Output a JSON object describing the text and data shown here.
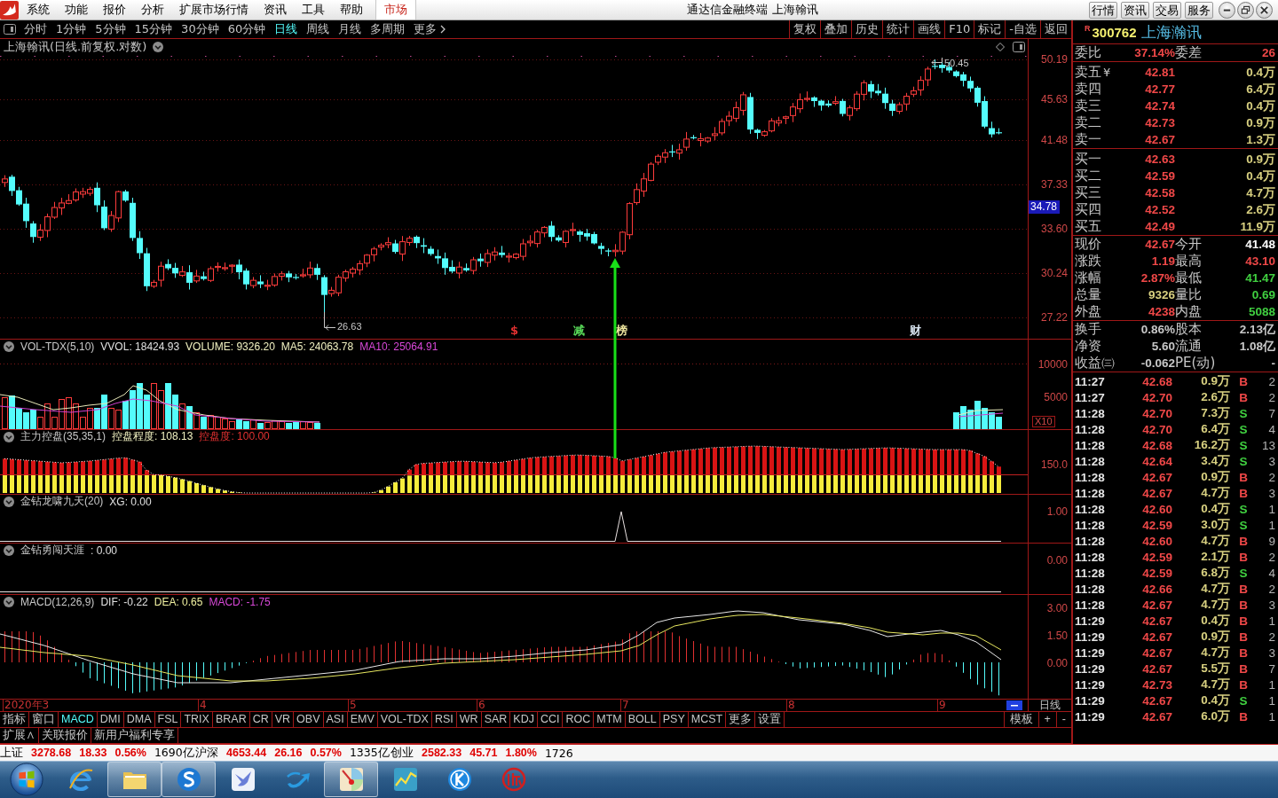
{
  "title_bar": {
    "menus": [
      "系统",
      "功能",
      "报价",
      "分析",
      "扩展市场行情",
      "资讯",
      "工具",
      "帮助"
    ],
    "tabs": [
      {
        "label": "市场",
        "selected": true
      }
    ],
    "title": "通达信金融终端 上海翰讯",
    "buttons": [
      "行情",
      "资讯",
      "交易",
      "服务"
    ]
  },
  "period_bar": {
    "periods": [
      {
        "label": "分时",
        "selected": false
      },
      {
        "label": "1分钟",
        "selected": false
      },
      {
        "label": "5分钟",
        "selected": false
      },
      {
        "label": "15分钟",
        "selected": false
      },
      {
        "label": "30分钟",
        "selected": false
      },
      {
        "label": "60分钟",
        "selected": false
      },
      {
        "label": "日线",
        "selected": true
      },
      {
        "label": "周线",
        "selected": false
      },
      {
        "label": "月线",
        "selected": false
      },
      {
        "label": "多周期",
        "selected": false
      }
    ],
    "more": "更多",
    "tools": [
      "复权",
      "叠加",
      "历史",
      "统计",
      "画线",
      "F10",
      "标记",
      "-自选",
      "返回"
    ]
  },
  "main_chart": {
    "title": "上海翰讯(日线.前复权.对数)",
    "price_ticks": [
      "50.19",
      "45.63",
      "41.48",
      "37.33",
      "33.60",
      "30.24",
      "27.22"
    ],
    "price_tag": "34.78",
    "high_label": "50.45",
    "low_label": "26.63",
    "events": [
      {
        "text": "$",
        "color": "#e03030"
      },
      {
        "text": "减",
        "color": "#58d858"
      },
      {
        "text": "榜",
        "color": "#f0e8a0"
      },
      {
        "text": "财",
        "color": "#d8e4f0"
      }
    ]
  },
  "indicators": [
    {
      "kind": "volume",
      "title": "VOL-TDX(5,10)",
      "readouts": [
        {
          "text": "VVOL: 18424.93",
          "color": "#e0e0e0"
        },
        {
          "text": "VOLUME: 9326.20",
          "color": "#f0f0c0"
        },
        {
          "text": "MA5: 24063.78",
          "color": "#f0f0c0"
        },
        {
          "text": "MA10: 25064.91",
          "color": "#d848d8"
        }
      ],
      "ticks": [
        "10000",
        "5000"
      ],
      "scale": "X10"
    },
    {
      "kind": "control",
      "title": "主力控盘(35,35,1)",
      "readouts": [
        {
          "text": "控盘程度: 108.13",
          "color": "#f0f0c0"
        },
        {
          "text": "控盘度: 100.00",
          "color": "#e03030"
        }
      ],
      "ticks": [
        "150.0"
      ]
    },
    {
      "kind": "signal",
      "title": "金钻龙啸九天(20)",
      "readouts": [
        {
          "text": "XG: 0.00",
          "color": "#e0e0e0"
        }
      ],
      "ticks": [
        "1.00"
      ]
    },
    {
      "kind": "flat",
      "title": "金钻勇闯天涯",
      "readouts": [
        {
          "text": ": 0.00",
          "color": "#e0e0e0"
        }
      ],
      "ticks": [
        "0.00"
      ]
    },
    {
      "kind": "macd",
      "title": "MACD(12,26,9)",
      "readouts": [
        {
          "text": "DIF: -0.22",
          "color": "#e0e0e0"
        },
        {
          "text": "DEA: 0.65",
          "color": "#f0f0a0"
        },
        {
          "text": "MACD: -1.75",
          "color": "#d848d8"
        }
      ],
      "ticks": [
        "3.00",
        "1.50",
        "0.00"
      ]
    }
  ],
  "date_axis": {
    "labels": [
      "2020年3",
      "4",
      "5",
      "6",
      "7",
      "8",
      "9"
    ],
    "period": "日线"
  },
  "indicator_tabs": {
    "items": [
      {
        "label": "指标",
        "selected": false
      },
      {
        "label": "窗口",
        "selected": false
      },
      {
        "label": "MACD",
        "selected": true
      },
      {
        "label": "DMI",
        "selected": false
      },
      {
        "label": "DMA",
        "selected": false
      },
      {
        "label": "FSL",
        "selected": false
      },
      {
        "label": "TRIX",
        "selected": false
      },
      {
        "label": "BRAR",
        "selected": false
      },
      {
        "label": "CR",
        "selected": false
      },
      {
        "label": "VR",
        "selected": false
      },
      {
        "label": "OBV",
        "selected": false
      },
      {
        "label": "ASI",
        "selected": false
      },
      {
        "label": "EMV",
        "selected": false
      },
      {
        "label": "VOL-TDX",
        "selected": false
      },
      {
        "label": "RSI",
        "selected": false
      },
      {
        "label": "WR",
        "selected": false
      },
      {
        "label": "SAR",
        "selected": false
      },
      {
        "label": "KDJ",
        "selected": false
      },
      {
        "label": "CCI",
        "selected": false
      },
      {
        "label": "ROC",
        "selected": false
      },
      {
        "label": "MTM",
        "selected": false
      },
      {
        "label": "BOLL",
        "selected": false
      },
      {
        "label": "PSY",
        "selected": false
      },
      {
        "label": "MCST",
        "selected": false
      },
      {
        "label": "更多",
        "selected": false
      },
      {
        "label": "设置",
        "selected": false
      }
    ],
    "right": [
      "模板",
      "+",
      "-"
    ]
  },
  "links": [
    "扩展∧",
    "关联报价",
    "新用户福利专享"
  ],
  "quote": {
    "flag": "R",
    "code": "300762",
    "name": "上海瀚讯",
    "order_ratio": [
      {
        "label": "委比",
        "value": "37.14%"
      },
      {
        "label": "委差",
        "value": "26"
      }
    ],
    "asks": [
      {
        "label": "卖五",
        "note": "¥",
        "price": "42.81",
        "volume": "0.4万"
      },
      {
        "label": "卖四",
        "price": "42.77",
        "volume": "6.4万"
      },
      {
        "label": "卖三",
        "price": "42.74",
        "volume": "0.4万"
      },
      {
        "label": "卖二",
        "price": "42.73",
        "volume": "0.9万"
      },
      {
        "label": "卖一",
        "price": "42.67",
        "volume": "1.3万"
      }
    ],
    "bids": [
      {
        "label": "买一",
        "price": "42.63",
        "volume": "0.9万"
      },
      {
        "label": "买二",
        "price": "42.59",
        "volume": "0.4万"
      },
      {
        "label": "买三",
        "price": "42.58",
        "volume": "4.7万"
      },
      {
        "label": "买四",
        "price": "42.52",
        "volume": "2.6万"
      },
      {
        "label": "买五",
        "price": "42.49",
        "volume": "11.9万"
      }
    ],
    "stats": [
      {
        "label": "现价",
        "value": "42.67",
        "color": "#f04848"
      },
      {
        "label": "今开",
        "value": "41.48",
        "color": "#ffffff"
      },
      {
        "label": "涨跌",
        "value": "1.19",
        "color": "#f04848"
      },
      {
        "label": "最高",
        "value": "43.10",
        "color": "#f04848"
      },
      {
        "label": "涨幅",
        "value": "2.87%",
        "color": "#f04848"
      },
      {
        "label": "最低",
        "value": "41.47",
        "color": "#40d040"
      },
      {
        "label": "总量",
        "value": "9326",
        "color": "#d8d080"
      },
      {
        "label": "量比",
        "value": "0.69",
        "color": "#40d040"
      },
      {
        "label": "外盘",
        "value": "4238",
        "color": "#f04848"
      },
      {
        "label": "内盘",
        "value": "5088",
        "color": "#40d040"
      }
    ],
    "fundamentals": [
      {
        "label": "换手",
        "value": "0.86%"
      },
      {
        "label": "股本",
        "value": "2.13亿"
      },
      {
        "label": "净资",
        "value": "5.60"
      },
      {
        "label": "流通",
        "value": "1.08亿"
      },
      {
        "label": "收益㈢",
        "value": "-0.062"
      },
      {
        "label": "PE(动)",
        "value": "-"
      }
    ],
    "trades": [
      {
        "time": "11:27",
        "price": "42.68",
        "volume": "0.9万",
        "side": "B",
        "kind": "buy",
        "count": "2"
      },
      {
        "time": "11:27",
        "price": "42.70",
        "volume": "2.6万",
        "side": "B",
        "kind": "buy",
        "count": "2"
      },
      {
        "time": "11:28",
        "price": "42.70",
        "volume": "7.3万",
        "side": "S",
        "kind": "sell",
        "count": "7"
      },
      {
        "time": "11:28",
        "price": "42.70",
        "volume": "6.4万",
        "side": "S",
        "kind": "sell",
        "count": "4"
      },
      {
        "time": "11:28",
        "price": "42.68",
        "volume": "16.2万",
        "side": "S",
        "kind": "sell",
        "count": "13"
      },
      {
        "time": "11:28",
        "price": "42.64",
        "volume": "3.4万",
        "side": "S",
        "kind": "sell",
        "count": "3"
      },
      {
        "time": "11:28",
        "price": "42.67",
        "volume": "0.9万",
        "side": "B",
        "kind": "buy",
        "count": "2"
      },
      {
        "time": "11:28",
        "price": "42.67",
        "volume": "4.7万",
        "side": "B",
        "kind": "buy",
        "count": "3"
      },
      {
        "time": "11:28",
        "price": "42.60",
        "volume": "0.4万",
        "side": "S",
        "kind": "sell",
        "count": "1"
      },
      {
        "time": "11:28",
        "price": "42.59",
        "volume": "3.0万",
        "side": "S",
        "kind": "sell",
        "count": "1"
      },
      {
        "time": "11:28",
        "price": "42.60",
        "volume": "4.7万",
        "side": "B",
        "kind": "buy",
        "count": "9"
      },
      {
        "time": "11:28",
        "price": "42.59",
        "volume": "2.1万",
        "side": "B",
        "kind": "buy",
        "count": "2"
      },
      {
        "time": "11:28",
        "price": "42.59",
        "volume": "6.8万",
        "side": "S",
        "kind": "sell",
        "count": "4"
      },
      {
        "time": "11:28",
        "price": "42.66",
        "volume": "4.7万",
        "side": "B",
        "kind": "buy",
        "count": "2"
      },
      {
        "time": "11:28",
        "price": "42.67",
        "volume": "4.7万",
        "side": "B",
        "kind": "buy",
        "count": "3"
      },
      {
        "time": "11:29",
        "price": "42.67",
        "volume": "0.4万",
        "side": "B",
        "kind": "buy",
        "count": "1"
      },
      {
        "time": "11:29",
        "price": "42.67",
        "volume": "0.9万",
        "side": "B",
        "kind": "buy",
        "count": "2"
      },
      {
        "time": "11:29",
        "price": "42.67",
        "volume": "4.7万",
        "side": "B",
        "kind": "buy",
        "count": "3"
      },
      {
        "time": "11:29",
        "price": "42.67",
        "volume": "5.5万",
        "side": "B",
        "kind": "buy",
        "count": "7"
      },
      {
        "time": "11:29",
        "price": "42.73",
        "volume": "4.7万",
        "side": "B",
        "kind": "buy",
        "count": "1"
      },
      {
        "time": "11:29",
        "price": "42.67",
        "volume": "0.4万",
        "side": "S",
        "kind": "sell",
        "count": "1"
      },
      {
        "time": "11:29",
        "price": "42.67",
        "volume": "6.0万",
        "side": "B",
        "kind": "buy",
        "count": "1"
      }
    ]
  },
  "status_bar": {
    "indices": [
      {
        "name": "上证",
        "value": "3278.68",
        "change": "18.33",
        "percent": "0.56%",
        "amount": "1690亿"
      },
      {
        "name": "沪深",
        "value": "4653.44",
        "change": "26.16",
        "percent": "0.57%",
        "amount": "1335亿"
      },
      {
        "name": "创业",
        "value": "2582.33",
        "change": "45.71",
        "percent": "1.80%",
        "amount": "1726"
      }
    ]
  },
  "taskbar": {
    "apps": [
      {
        "kind": "e",
        "running": false
      },
      {
        "kind": "folder",
        "running": true
      },
      {
        "kind": "s",
        "running": true
      },
      {
        "kind": "bird",
        "running": false
      },
      {
        "kind": "swoosh",
        "running": false
      },
      {
        "kind": "pie",
        "running": true
      },
      {
        "kind": "chart",
        "running": false
      },
      {
        "kind": "k",
        "running": false
      },
      {
        "kind": "seal",
        "running": false
      }
    ]
  }
}
